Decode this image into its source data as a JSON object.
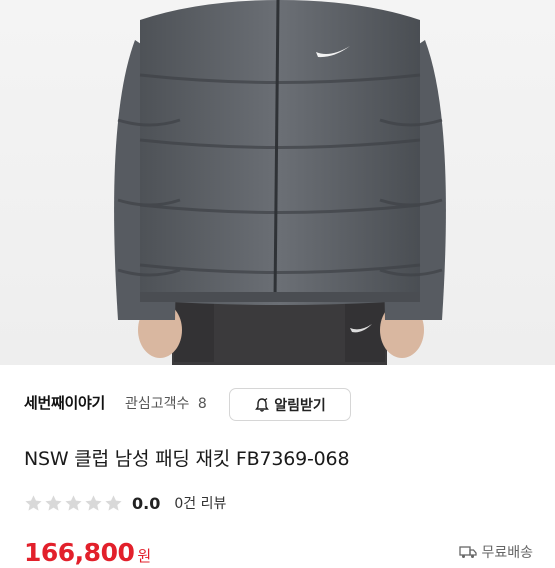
{
  "product_image": {
    "brand_mark": "nike-swoosh"
  },
  "store": {
    "name": "세번째이야기",
    "followers_label": "관심고객수",
    "followers_count": "8",
    "alarm_button_label": "알림받기"
  },
  "product": {
    "title": "NSW 클럽 남성 패딩 재킷 FB7369-068",
    "rating_value": 0.0,
    "rating_text": "0.0",
    "review_count_text": "0건 리뷰",
    "price_value": "166,800",
    "price_unit": "원",
    "shipping_label": "무료배송"
  },
  "colors": {
    "price": "#e2202b",
    "star_empty": "#d9d9d9",
    "jacket": "#5f6369"
  },
  "icons": [
    "bell-icon",
    "star-icon",
    "shipping-icon"
  ]
}
